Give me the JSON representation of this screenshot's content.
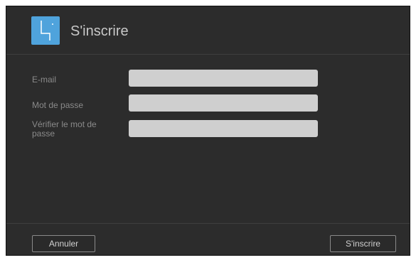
{
  "header": {
    "title": "S'inscrire",
    "icon": "app-logo-icon",
    "icon_color": "#4fa3dc"
  },
  "form": {
    "fields": [
      {
        "label": "E-mail",
        "value": "",
        "placeholder": ""
      },
      {
        "label": "Mot de passe",
        "value": "",
        "placeholder": ""
      },
      {
        "label_line1": "Vérifier le mot de",
        "label_line2": "passe",
        "value": "",
        "placeholder": ""
      }
    ]
  },
  "footer": {
    "cancel_label": "Annuler",
    "submit_label": "S'inscrire"
  }
}
